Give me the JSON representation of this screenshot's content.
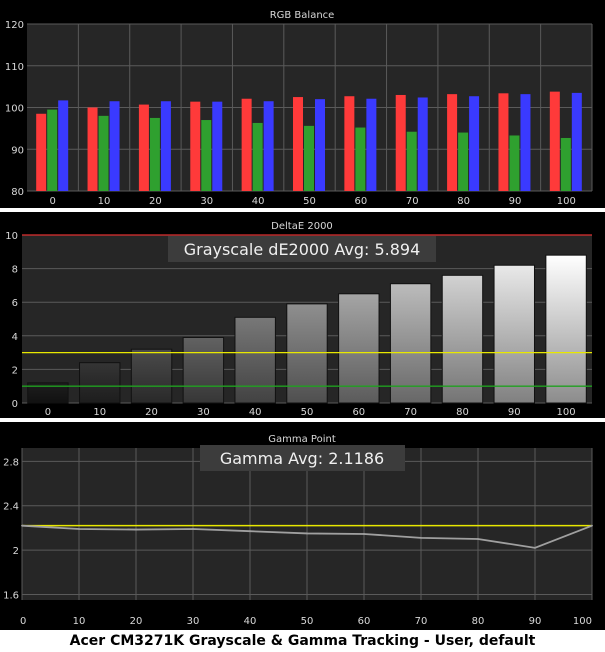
{
  "caption": "Acer CM3271K Grayscale & Gamma Tracking - User, default",
  "colors": {
    "panel_bg": "#000000",
    "plot_bg": "#262626",
    "grid": "#5a5a5a",
    "text": "#d8d8d8",
    "red": "#ff3a3a",
    "green": "#2fa02f",
    "blue": "#3a3aff",
    "yellow": "#e8e800",
    "limit_red": "#e03030",
    "limit_green": "#20a020",
    "gamma_line": "#a0a0a0",
    "annotation_bg": "#3c3c3c"
  },
  "chart_data": [
    {
      "type": "bar",
      "title": "RGB Balance",
      "categories": [
        "0",
        "10",
        "20",
        "30",
        "40",
        "50",
        "60",
        "70",
        "80",
        "90",
        "100"
      ],
      "ylim": [
        80,
        120
      ],
      "yticks": [
        80,
        90,
        100,
        110,
        120
      ],
      "grid": true,
      "series": [
        {
          "color_key": "red",
          "values": [
            98.5,
            100,
            100.7,
            101.4,
            102.1,
            102.5,
            102.7,
            103,
            103.2,
            103.4,
            103.8
          ]
        },
        {
          "color_key": "green",
          "values": [
            99.5,
            98,
            97.5,
            97,
            96.3,
            95.6,
            95.2,
            94.2,
            94,
            93.3,
            92.7
          ]
        },
        {
          "color_key": "blue",
          "values": [
            101.7,
            101.5,
            101.5,
            101.4,
            101.5,
            102,
            102.1,
            102.4,
            102.7,
            103.2,
            103.5
          ]
        }
      ]
    },
    {
      "type": "bar",
      "title": "DeltaE 2000",
      "annotation": "Grayscale dE2000 Avg: 5.894",
      "categories": [
        "0",
        "10",
        "20",
        "30",
        "40",
        "50",
        "60",
        "70",
        "80",
        "90",
        "100"
      ],
      "values": [
        1.2,
        2.4,
        3.2,
        3.9,
        5.1,
        5.9,
        6.5,
        7.1,
        7.6,
        8.2,
        8.8
      ],
      "ylim": [
        0,
        10
      ],
      "yticks": [
        0,
        2,
        4,
        6,
        8,
        10
      ],
      "thresholds": [
        {
          "value": 10,
          "color_key": "limit_red"
        },
        {
          "value": 3,
          "color_key": "yellow"
        },
        {
          "value": 1,
          "color_key": "limit_green"
        }
      ],
      "grid": true
    },
    {
      "type": "line",
      "title": "Gamma Point",
      "annotation": "Gamma Avg: 2.1186",
      "x": [
        0,
        10,
        20,
        30,
        40,
        50,
        60,
        70,
        80,
        90,
        100
      ],
      "y": [
        2.22,
        2.19,
        2.185,
        2.19,
        2.17,
        2.15,
        2.145,
        2.11,
        2.1,
        2.02,
        2.22
      ],
      "xticks": [
        0,
        10,
        20,
        30,
        40,
        50,
        60,
        70,
        80,
        90,
        100
      ],
      "ylim": [
        1.55,
        2.92
      ],
      "yticks": [
        1.6,
        2,
        2.4,
        2.8
      ],
      "ytick_labels": [
        "1.6",
        "2",
        "2.4",
        "2.8"
      ],
      "reference": {
        "value": 2.22,
        "color_key": "yellow"
      },
      "grid": true
    }
  ]
}
